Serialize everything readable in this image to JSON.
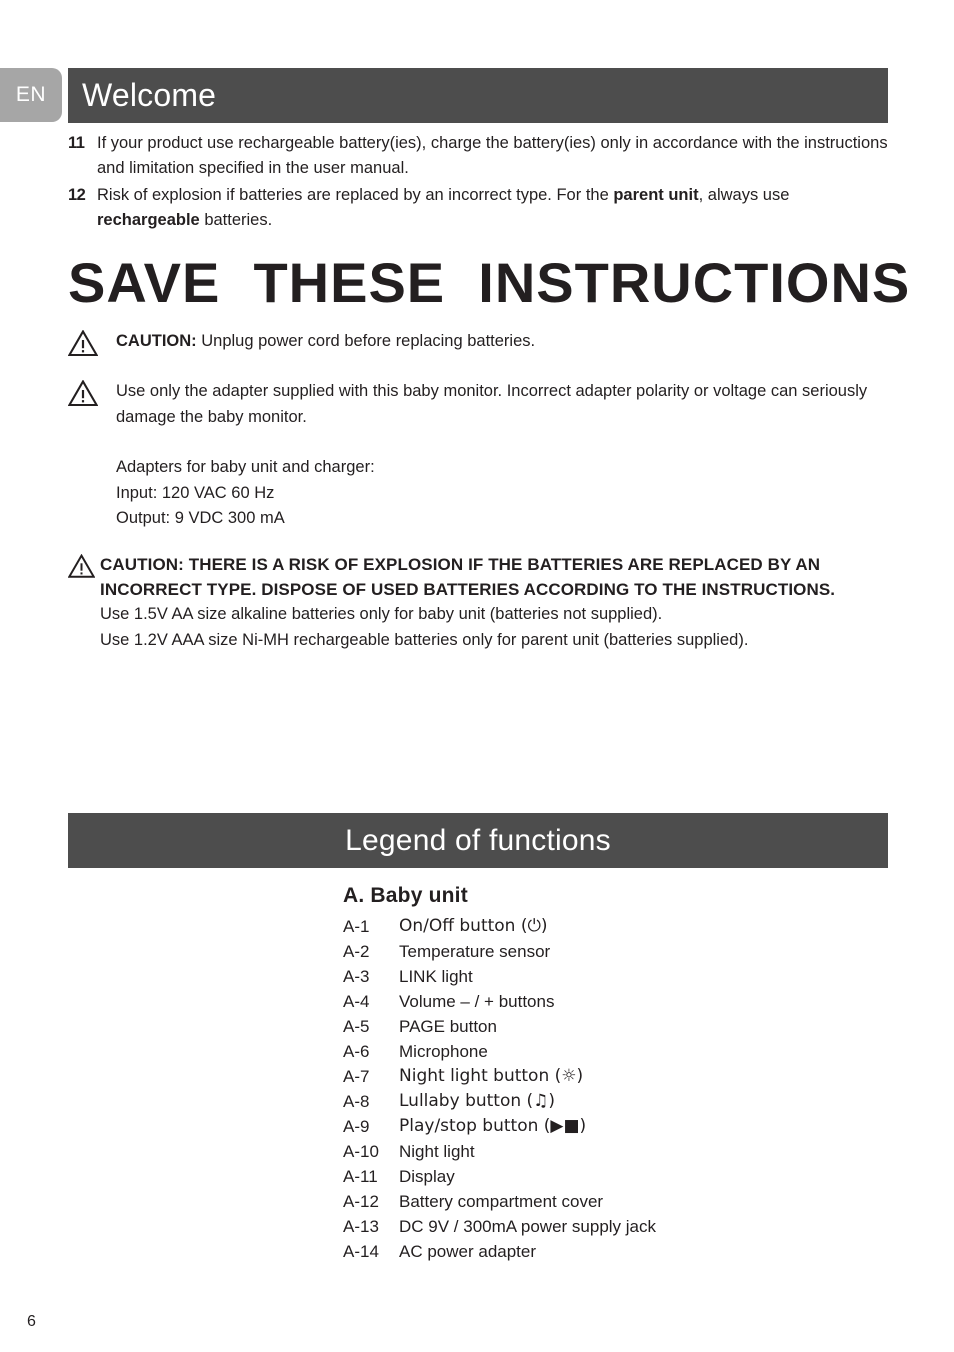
{
  "language_tab": "EN",
  "header": {
    "title": "Welcome"
  },
  "numbered_items": [
    {
      "number": "11",
      "text_before": "If your product use rechargeable battery(ies), charge the battery(ies) only in accordance with the instructions and limitation specified in the user manual.",
      "bold1": "",
      "text_mid": "",
      "bold2": "",
      "text_after": ""
    },
    {
      "number": "12",
      "text_before": "Risk of explosion if batteries are replaced by an incorrect type. For the ",
      "bold1": "parent unit",
      "text_mid": ", always use ",
      "bold2": "rechargeable",
      "text_after": " batteries."
    }
  ],
  "headline": "SAVE  THESE  INSTRUCTIONS",
  "caution_1": {
    "label": "CAUTION:",
    "text": " Unplug power cord before replacing batteries."
  },
  "caution_2": {
    "text": "Use only the adapter supplied with this baby monitor. Incorrect adapter polarity or voltage can seriously damage the baby monitor."
  },
  "adapter_spec": [
    "Adapters for baby unit and charger:",
    "Input: 120 VAC 60 Hz",
    "Output: 9 VDC 300 mA"
  ],
  "caution_3": {
    "caps_text": "CAUTION: THERE IS A RISK OF EXPLOSION IF THE BATTERIES ARE REPLACED BY AN INCORRECT TYPE. DISPOSE OF USED BATTERIES ACCORDING TO THE INSTRUCTIONS.",
    "line_1": "Use 1.5V AA size alkaline batteries only for baby unit (batteries not supplied).",
    "line_2": "Use 1.2V AAA size Ni-MH rechargeable batteries only for parent unit (batteries supplied)."
  },
  "legend_header": {
    "title": "Legend of functions"
  },
  "legend": {
    "section_title": "A. Baby unit",
    "items": [
      {
        "code": "A-1",
        "label": "On/Off button (⏻)"
      },
      {
        "code": "A-2",
        "label": "Temperature sensor"
      },
      {
        "code": "A-3",
        "label": "LINK light"
      },
      {
        "code": "A-4",
        "label": "Volume – / + buttons"
      },
      {
        "code": "A-5",
        "label": "PAGE button"
      },
      {
        "code": "A-6",
        "label": "Microphone"
      },
      {
        "code": "A-7",
        "label": "Night light button (☼)"
      },
      {
        "code": "A-8",
        "label": "Lullaby button (♫)"
      },
      {
        "code": "A-9",
        "label": "Play/stop button (▶■)"
      },
      {
        "code": "A-10",
        "label": "Night light"
      },
      {
        "code": "A-11",
        "label": "Display"
      },
      {
        "code": "A-12",
        "label": "Battery compartment cover"
      },
      {
        "code": "A-13",
        "label": "DC 9V / 300mA power supply jack"
      },
      {
        "code": "A-14",
        "label": "AC power adapter"
      }
    ]
  },
  "page_number": "6",
  "colors": {
    "bar_dark": "#4d4d4d",
    "tab_gray": "#a6a6a6",
    "text": "#231f20"
  }
}
